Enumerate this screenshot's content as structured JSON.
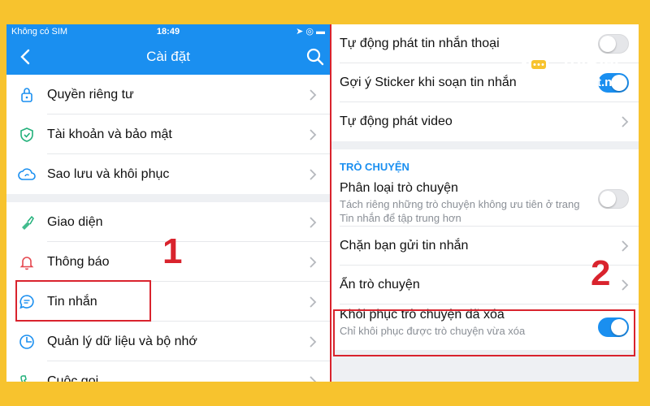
{
  "status_bar": {
    "carrier": "Không có SIM",
    "time": "18:49",
    "right_icons": "➤ ◎ ▬"
  },
  "nav": {
    "title": "Cài đặt",
    "back_icon": "chevron-left-icon",
    "search_icon": "search-icon"
  },
  "settings_groups": [
    {
      "items": [
        {
          "label": "Quyền riêng tư",
          "icon": "lock-icon"
        },
        {
          "label": "Tài khoản và bảo mật",
          "icon": "shield-icon"
        },
        {
          "label": "Sao lưu và khôi phục",
          "icon": "cloud-sync-icon"
        }
      ]
    },
    {
      "items": [
        {
          "label": "Giao diện",
          "icon": "brush-icon"
        },
        {
          "label": "Thông báo",
          "icon": "bell-icon"
        },
        {
          "label": "Tin nhắn",
          "icon": "chat-icon"
        },
        {
          "label": "Quản lý dữ liệu và bộ nhớ",
          "icon": "clock-pie-icon"
        },
        {
          "label": "Cuộc gọi",
          "icon": "phone-icon"
        }
      ]
    }
  ],
  "annotations": {
    "step1": "1",
    "step2": "2"
  },
  "messages_settings": {
    "top_rows": [
      {
        "label": "Tự động phát tin nhắn thoại",
        "toggle": false
      },
      {
        "label": "Gợi ý Sticker khi soạn tin nhắn",
        "toggle": true
      },
      {
        "label": "Tự động phát video",
        "chevron": true
      }
    ],
    "section_title": "TRÒ CHUYỆN",
    "classify": {
      "label": "Phân loại trò chuyện",
      "sub": "Tách riêng những trò chuyện không ưu tiên ở trang Tin nhắn để tập trung hơn",
      "toggle": false
    },
    "block": {
      "label": "Chặn bạn gửi tin nhắn"
    },
    "hide": {
      "label": "Ẩn trò chuyện"
    },
    "restore": {
      "label": "Khôi phục trò chuyện đã xóa",
      "sub": "Chỉ khôi phục được trò chuyện vừa xóa",
      "toggle": true
    }
  },
  "logo": {
    "brand": "ToiBiet",
    "domain": "toibiet.net"
  },
  "colors": {
    "accent": "#1a8ff0",
    "highlight": "#d9232d",
    "background": "#f7c32e"
  }
}
